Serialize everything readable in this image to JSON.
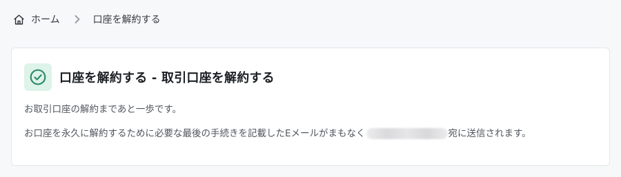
{
  "breadcrumb": {
    "home_label": "ホーム",
    "current_label": "口座を解約する"
  },
  "card": {
    "title": "口座を解約する - 取引口座を解約する",
    "line1": "お取引口座の解約まであと一歩です。",
    "line2_before": "お口座を永久に解約するために必要な最後の手続きを記載したEメールがまもなく",
    "line2_after": "宛に送信されます。"
  },
  "icons": {
    "home": "home-icon",
    "separator": "chevron-right-icon",
    "status": "check-circle-icon"
  },
  "colors": {
    "success": "#2e8b66",
    "success_bg": "#def3ea"
  }
}
